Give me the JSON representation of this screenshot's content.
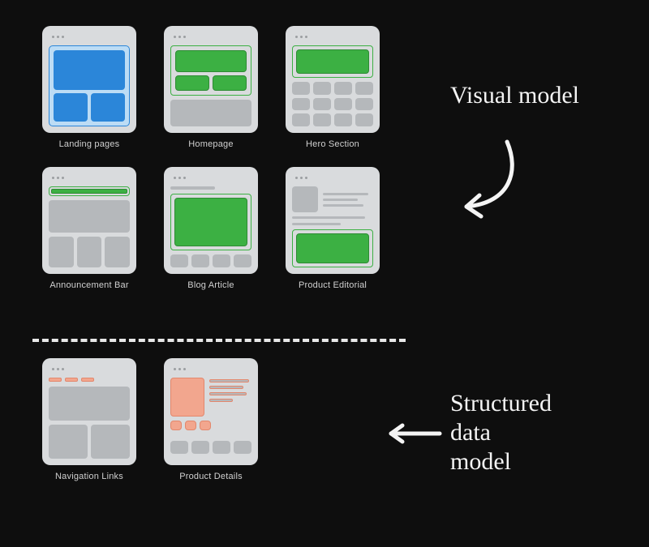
{
  "sections": {
    "top_heading": "Visual model",
    "bottom_heading": "Structured\ndata\nmodel"
  },
  "cards_top": [
    {
      "id": "landing-pages",
      "label": "Landing pages"
    },
    {
      "id": "homepage",
      "label": "Homepage"
    },
    {
      "id": "hero-section",
      "label": "Hero Section"
    },
    {
      "id": "announcement-bar",
      "label": "Announcement Bar"
    },
    {
      "id": "blog-article",
      "label": "Blog Article"
    },
    {
      "id": "product-editorial",
      "label": "Product Editorial"
    }
  ],
  "cards_bottom": [
    {
      "id": "navigation-links",
      "label": "Navigation Links"
    },
    {
      "id": "product-details",
      "label": "Product Details"
    }
  ],
  "colors": {
    "background": "#0e0e0e",
    "card_bg": "#d9dbdd",
    "grey": "#b5b8bb",
    "green": "#3cb043",
    "blue": "#2b86d9",
    "salmon": "#f2a68e",
    "text": "#e8e8e8"
  }
}
